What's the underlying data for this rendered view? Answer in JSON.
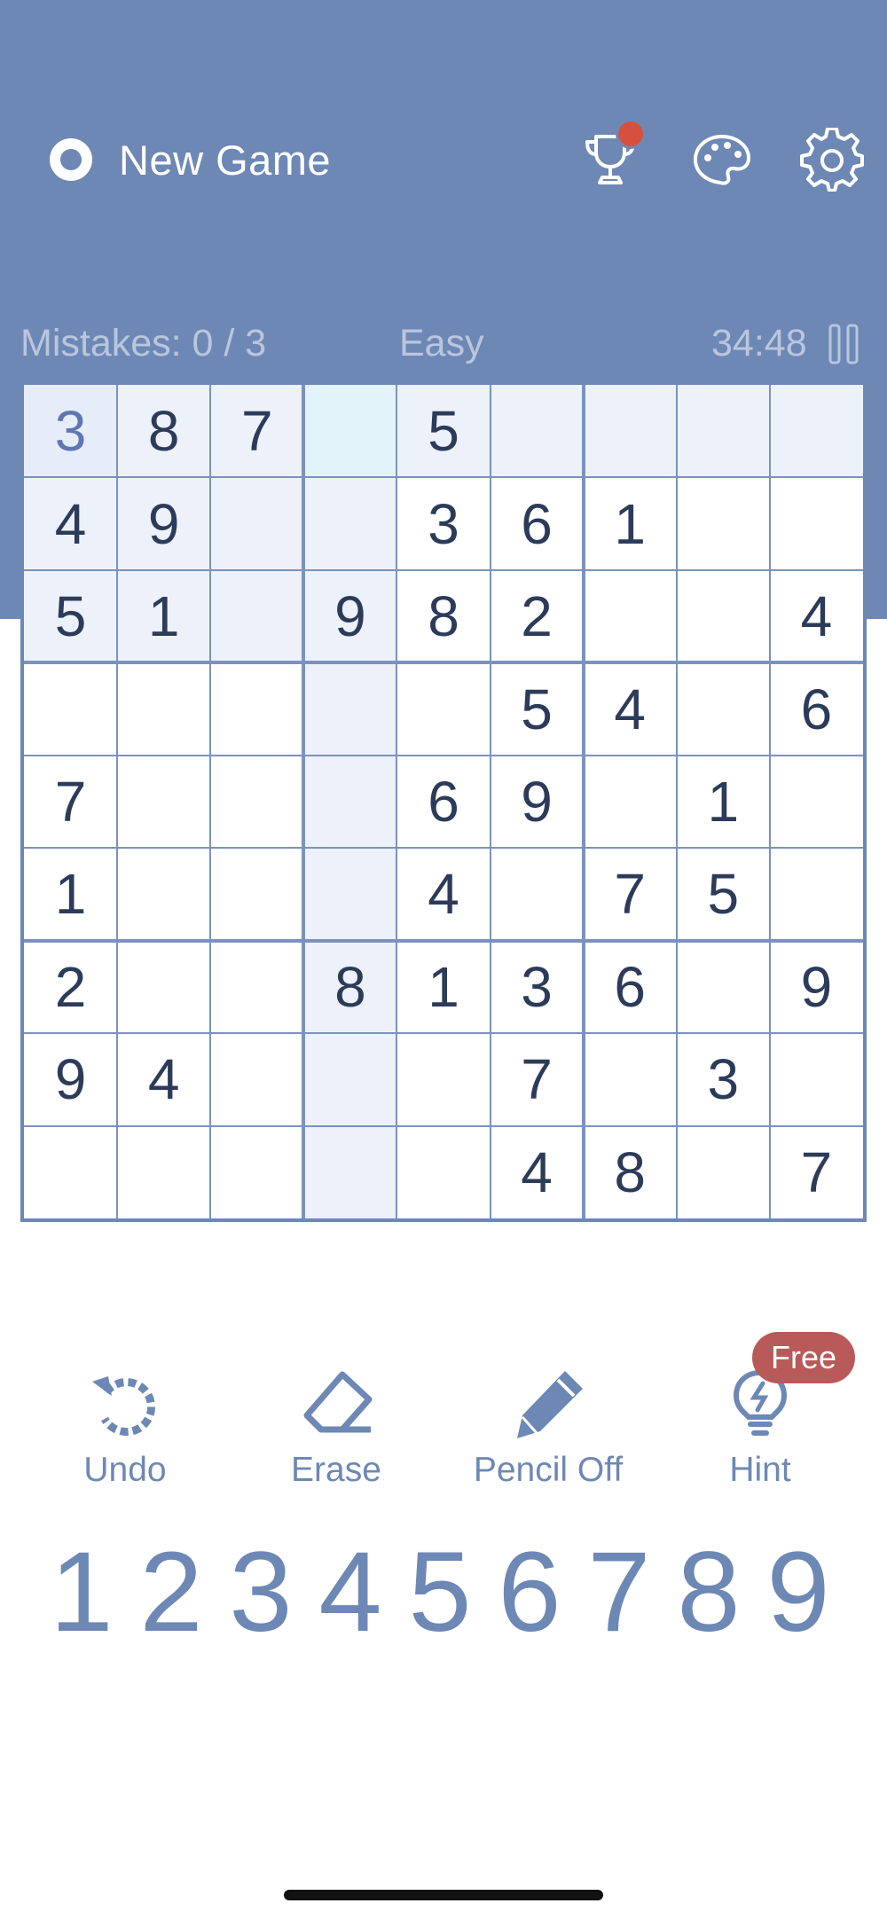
{
  "header": {
    "new_game_label": "New Game",
    "icons": [
      "trophy-icon",
      "palette-icon",
      "gear-icon"
    ]
  },
  "status": {
    "mistakes": "Mistakes: 0 / 3",
    "difficulty": "Easy",
    "timer": "34:48"
  },
  "board": {
    "selected": {
      "row": 0,
      "col": 0
    },
    "rows": [
      [
        "3",
        "8",
        "7",
        "",
        "5",
        "",
        "",
        "",
        ""
      ],
      [
        "4",
        "9",
        "",
        "",
        "3",
        "6",
        "1",
        "",
        ""
      ],
      [
        "5",
        "1",
        "",
        "9",
        "8",
        "2",
        "",
        "",
        "4"
      ],
      [
        "",
        "",
        "",
        "",
        "",
        "5",
        "4",
        "",
        "6"
      ],
      [
        "7",
        "",
        "",
        "",
        "6",
        "9",
        "",
        "1",
        ""
      ],
      [
        "1",
        "",
        "",
        "",
        "4",
        "",
        "7",
        "5",
        ""
      ],
      [
        "2",
        "",
        "",
        "8",
        "1",
        "3",
        "6",
        "",
        "9"
      ],
      [
        "9",
        "4",
        "",
        "",
        "",
        "7",
        "",
        "3",
        ""
      ],
      [
        "",
        "",
        "",
        "",
        "",
        "4",
        "8",
        "",
        "7"
      ]
    ],
    "user_entries": [
      [
        0,
        0
      ]
    ],
    "colors": {
      "selected": "#e6ecf8",
      "related": "#edf1f9",
      "focus": "#e2f3f9",
      "line": "#7b92be"
    }
  },
  "tools": [
    {
      "id": "undo",
      "label": "Undo",
      "icon": "undo-icon"
    },
    {
      "id": "erase",
      "label": "Erase",
      "icon": "eraser-icon"
    },
    {
      "id": "pencil",
      "label": "Pencil Off",
      "icon": "pencil-icon"
    },
    {
      "id": "hint",
      "label": "Hint",
      "icon": "lightbulb-icon",
      "badge": "Free"
    }
  ],
  "numpad": [
    "1",
    "2",
    "3",
    "4",
    "5",
    "6",
    "7",
    "8",
    "9"
  ]
}
